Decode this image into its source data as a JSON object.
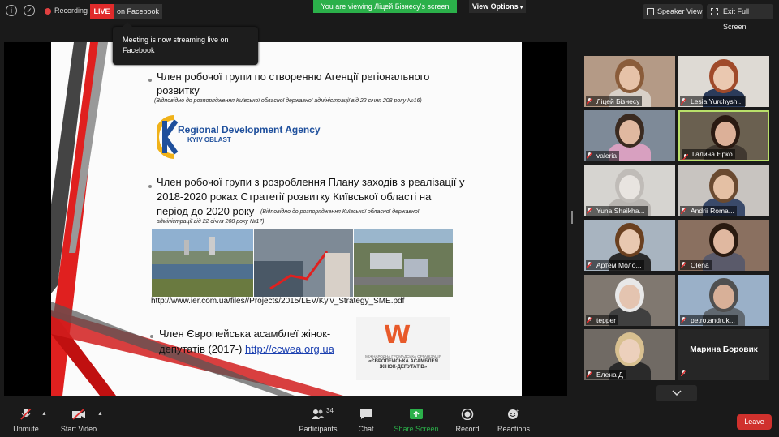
{
  "topbar": {
    "recording_label": "Recording",
    "live_label": "LIVE",
    "live_platform": "on Facebook",
    "viewing_banner": "You are viewing Ліцей Бізнесу's screen",
    "view_options": "View Options",
    "speaker_view": "Speaker View",
    "exit_full_screen": "Exit Full Screen"
  },
  "tooltip": "Meeting is now streaming live on Facebook",
  "slide": {
    "item1_line1": "Член робочої групи по створенню Агенції регіонального",
    "item1_line2": "розвитку",
    "item1_note": "(Відповідно до розпорядження Київської обласної державної адміністрації від 22 січня 208 року №16)",
    "rda_title": "Regional Development Agency",
    "rda_subtitle": "KYIV OBLAST",
    "item2_line1": "Член робочої групи з розроблення Плану заходів з реалізації у",
    "item2_line2": "2018-2020 роках Стратегії розвитку Київської області на",
    "item2_line3": "період до 2020 року",
    "item2_note_a": "(Відповідно до розпорядження Київської обласної державної",
    "item2_note_b": "адміністрації від 22 січня 208 року №17)",
    "url": "http://www.ier.com.ua/files//Projects/2015/LEV/Kyiv_Strategy_SME.pdf",
    "item3_line1": "Член Європейська асамблеї жінок-",
    "item3_line2_text": "депутатів (2017-) ",
    "item3_link": "http://ccwea.org.ua",
    "ew_small": "МІЖНАРОДНА ГРОМАДСЬКА ОРГАНІЗАЦІЯ",
    "ew_name_a": "«ЄВРОПЕЙСЬКА АСАМБЛЕЯ",
    "ew_name_b": "ЖІНОК-ДЕПУТАТІВ»"
  },
  "participants": [
    {
      "name": "Ліцей Бізнесу"
    },
    {
      "name": "Lesia Yurchysh..."
    },
    {
      "name": "valeria"
    },
    {
      "name": "Галина Єрко"
    },
    {
      "name": "Yuna Shaikha..."
    },
    {
      "name": "Andrii Roma..."
    },
    {
      "name": "Артем Моло..."
    },
    {
      "name": "Olena"
    },
    {
      "name": "tepper"
    },
    {
      "name": "petro.andruk..."
    },
    {
      "name": "Елена Д"
    },
    {
      "name": "Марина Боровик"
    }
  ],
  "controls": {
    "unmute": "Unmute",
    "start_video": "Start Video",
    "participants": "Participants",
    "participants_count": "34",
    "chat": "Chat",
    "share_screen": "Share Screen",
    "record": "Record",
    "reactions": "Reactions",
    "leave": "Leave"
  },
  "colors": {
    "live_red": "#e02b2b",
    "banner_green": "#2bb04a",
    "active_speaker": "#b9e06a",
    "leave_red": "#d0312d"
  }
}
